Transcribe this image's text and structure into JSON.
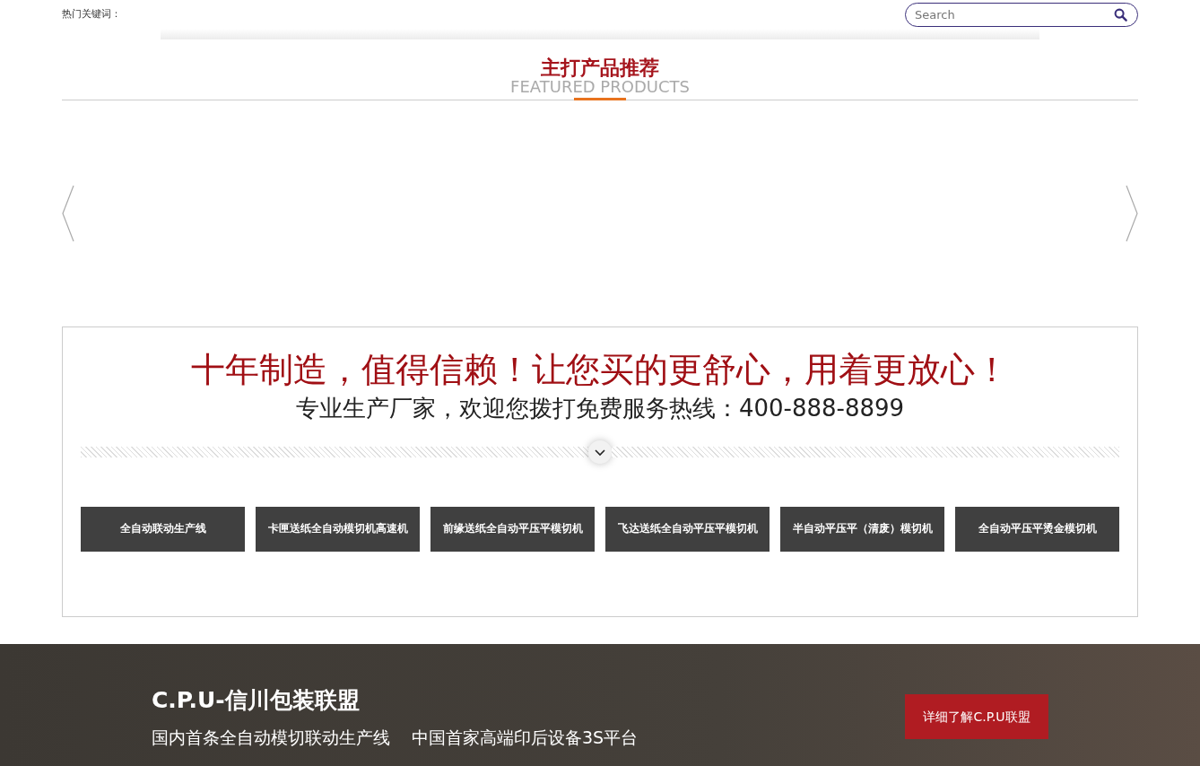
{
  "topbar": {
    "hot_keywords_label": "热门关键词：",
    "search": {
      "placeholder": "Search"
    }
  },
  "featured": {
    "title": "主打产品推荐",
    "subtitle": "FEATURED PRODUCTS"
  },
  "slogan": {
    "headline": "十年制造，值得信赖！让您买的更舒心，用着更放心！",
    "hotline": "专业生产厂家，欢迎您拨打免费服务热线：400-888-8899"
  },
  "categories": [
    "全自动联动生产线",
    "卡匣送纸全自动模切机高速机",
    "前缘送纸全自动平压平模切机",
    "飞达送纸全自动平压平模切机",
    "半自动平压平（清废）模切机",
    "全自动平压平烫金模切机"
  ],
  "banner": {
    "title": "C.P.U-信川包装联盟",
    "taglines": [
      "国内首条全自动模切联动生产线",
      "中国首家高端印后设备3S平台"
    ],
    "button": "详细了解C.P.U联盟"
  }
}
